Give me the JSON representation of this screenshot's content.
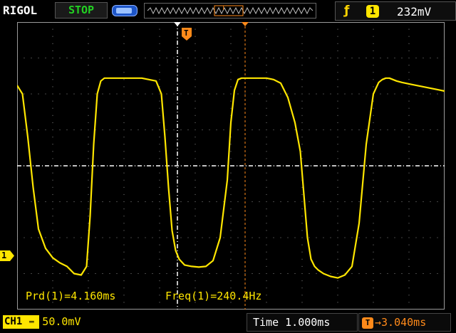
{
  "header": {
    "brand": "RIGOL",
    "run_state": "STOP",
    "memory_icon": "memory-depth-icon",
    "trigger": {
      "edge_icon": "rising-edge-icon",
      "edge_glyph": "ƒ",
      "source": "1",
      "level": "232mV"
    }
  },
  "screen": {
    "trigger_position_marker": "T",
    "channel_marker": "1"
  },
  "measurements": {
    "period": "Prd(1)=4.160ms",
    "frequency": "Freq(1)=240.4Hz"
  },
  "footer": {
    "channel": "CH1",
    "coupling_icon": "dc-coupling-icon",
    "coupling_glyph": "═",
    "volts_per_div": "50.0mV",
    "time_label": "Time",
    "time_per_div": "1.000ms",
    "delay_icon": "T",
    "delay": "→3.040ms"
  },
  "colors": {
    "trace": "#ffe600",
    "grid": "#9a9a9a",
    "run_state": "#22d022",
    "cursor": "#ff8a1a"
  },
  "chart_data": {
    "type": "line",
    "title": "",
    "xlabel": "",
    "ylabel": "",
    "grid": true,
    "note_units": "x in ms relative to screen center (trigger); y in mV relative to screen center",
    "xlim": [
      -6,
      6
    ],
    "ylim": [
      -200,
      200
    ],
    "series": [
      {
        "name": "",
        "x": [
          -6.0,
          -5.85,
          -5.7,
          -5.55,
          -5.4,
          -5.2,
          -5.0,
          -4.8,
          -4.6,
          -4.4,
          -4.2,
          -4.05,
          -3.95,
          -3.85,
          -3.75,
          -3.65,
          -3.55,
          -3.45,
          -3.3,
          -3.1,
          -2.9,
          -2.7,
          -2.5,
          -2.3,
          -2.1,
          -1.95,
          -1.85,
          -1.75,
          -1.65,
          -1.55,
          -1.45,
          -1.3,
          -1.1,
          -0.9,
          -0.7,
          -0.5,
          -0.3,
          -0.1,
          0.0,
          0.1,
          0.2,
          0.3,
          0.45,
          0.6,
          0.8,
          1.0,
          1.2,
          1.4,
          1.6,
          1.8,
          1.95,
          2.05,
          2.15,
          2.25,
          2.35,
          2.45,
          2.6,
          2.8,
          3.0,
          3.2,
          3.4,
          3.6,
          3.8,
          4.0,
          4.15,
          4.25,
          4.35,
          4.45,
          4.55,
          4.65,
          4.8,
          5.0,
          5.2,
          5.4,
          5.6,
          5.8,
          6.0
        ],
        "y": [
          112,
          100,
          40,
          -30,
          -88,
          -115,
          -128,
          -135,
          -140,
          -150,
          -152,
          -140,
          -70,
          30,
          100,
          118,
          122,
          122,
          122,
          122,
          122,
          122,
          122,
          120,
          118,
          100,
          40,
          -30,
          -90,
          -118,
          -130,
          -138,
          -140,
          -141,
          -140,
          -132,
          -100,
          -20,
          60,
          105,
          120,
          122,
          122,
          122,
          122,
          122,
          120,
          115,
          95,
          60,
          20,
          -40,
          -100,
          -130,
          -140,
          -145,
          -150,
          -154,
          -156,
          -152,
          -140,
          -80,
          30,
          100,
          116,
          120,
          122,
          122,
          120,
          118,
          116,
          114,
          112,
          110,
          108,
          106,
          104
        ]
      }
    ]
  }
}
